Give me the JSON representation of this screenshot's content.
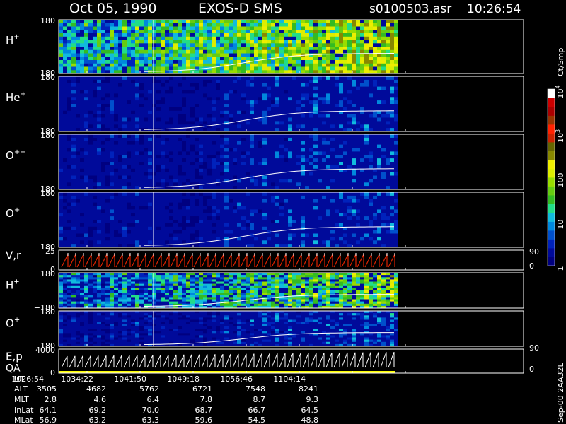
{
  "header": {
    "date": "Oct 05, 1990",
    "instrument": "EXOS-D SMS",
    "file": "s0100503.asr",
    "time": "10:26:54"
  },
  "chart_data": {
    "type": "heatmap",
    "panels": [
      {
        "label": "H",
        "sup": "+",
        "ytop": "180",
        "ybot": "−180",
        "kind": "spectro",
        "seed": 11,
        "density": 0.95,
        "level": 0.62,
        "gap": 0
      },
      {
        "label": "He",
        "sup": "+",
        "ytop": "180",
        "ybot": "−180",
        "kind": "spectro",
        "seed": 23,
        "density": 0.35,
        "level": 0.25,
        "gap": 1
      },
      {
        "label": "O",
        "sup": "++",
        "ytop": "180",
        "ybot": "−180",
        "kind": "spectro",
        "seed": 37,
        "density": 0.35,
        "level": 0.25,
        "gap": 1
      },
      {
        "label": "O",
        "sup": "+",
        "ytop": "180",
        "ybot": "−180",
        "kind": "spectro",
        "seed": 41,
        "density": 0.35,
        "level": 0.25,
        "gap": 1
      },
      {
        "label": "V,r",
        "sup": "",
        "ytop": "25",
        "ybot": "0",
        "kind": "vr",
        "right_top": "90",
        "right_bot": "0"
      },
      {
        "label": "H",
        "sup": "+",
        "ytop": "180",
        "ybot": "−180",
        "kind": "spectro",
        "seed": 53,
        "density": 0.8,
        "level": 0.5,
        "gap": 0
      },
      {
        "label": "O",
        "sup": "+",
        "ytop": "180",
        "ybot": "−180",
        "kind": "spectro",
        "seed": 67,
        "density": 0.4,
        "level": 0.25,
        "gap": 1
      },
      {
        "label": "E,p",
        "label2": "QA",
        "sup": "",
        "ytop": "4000",
        "ybot": "0",
        "kind": "ep",
        "right_top": "90",
        "right_bot": "0"
      }
    ],
    "colorbar": {
      "unit": "Ct/Smp",
      "ticks": [
        {
          "label": "1",
          "sup": "",
          "frac": 0.0
        },
        {
          "label": "10",
          "sup": "",
          "frac": 0.25
        },
        {
          "label": "100",
          "sup": "",
          "frac": 0.5
        },
        {
          "label": "10",
          "sup": "3",
          "frac": 0.75
        },
        {
          "label": "10",
          "sup": "4",
          "frac": 1.0
        }
      ],
      "colors": [
        "#000080",
        "#000a9a",
        "#0022bb",
        "#0050cc",
        "#0088dd",
        "#11bbdd",
        "#22dd88",
        "#33bb22",
        "#66cc11",
        "#99dd00",
        "#ddee00",
        "#eeee00",
        "#888800",
        "#666600",
        "#cc2200",
        "#ff2200",
        "#993300",
        "#aa0000",
        "#cc0000",
        "#ffffff"
      ]
    },
    "orbit": {
      "labels": [
        "UT",
        "ALT",
        "MLT",
        "InLat",
        "MLat"
      ],
      "columns": [
        [
          "1026:54",
          "3505",
          "2.8",
          "64.1",
          "−56.9"
        ],
        [
          "1034:22",
          "4682",
          "4.6",
          "69.2",
          "−63.2"
        ],
        [
          "1041:50",
          "5762",
          "6.4",
          "70.0",
          "−63.3"
        ],
        [
          "1049:18",
          "6721",
          "7.8",
          "68.7",
          "−59.6"
        ],
        [
          "1056:46",
          "7548",
          "8.7",
          "66.7",
          "−54.5"
        ],
        [
          "1104:14",
          "8241",
          "9.3",
          "64.5",
          "−48.8"
        ]
      ]
    },
    "footer_vertical": "Sep-00  2AA32L"
  }
}
